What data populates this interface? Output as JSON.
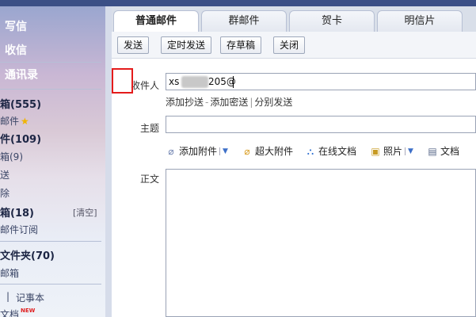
{
  "sidebar": {
    "write": "写信",
    "inbox": "收信",
    "contacts": "通讯录",
    "inbox_count": "箱(555)",
    "starred": "邮件",
    "unread": "件(109)",
    "drafts": "箱(9)",
    "sent": "送",
    "deleted": "除",
    "junk": "箱(18)",
    "junk_clear": "[清空]",
    "subscriptions": "邮件订阅",
    "folders": "文件夹(70)",
    "other_mailbox": "邮箱",
    "notes_sep": "|",
    "notes": "记事本",
    "docs": "文档",
    "new_badge": "NEW"
  },
  "tabs": [
    {
      "label": "普通邮件",
      "active": true
    },
    {
      "label": "群邮件",
      "active": false
    },
    {
      "label": "贺卡",
      "active": false
    },
    {
      "label": "明信片",
      "active": false
    }
  ],
  "toolbar": {
    "send": "发送",
    "scheduled_send": "定时发送",
    "save_draft": "存草稿",
    "close": "关闭"
  },
  "compose": {
    "to_label": "收件人",
    "to_value_start": "xs",
    "to_value_end": "205@",
    "add_cc": "添加抄送",
    "add_bcc": "添加密送",
    "separate_send": "分别发送",
    "link_sep_1": "-",
    "link_sep_2": "|",
    "subject_label": "主题",
    "subject_value": "",
    "body_label": "正文"
  },
  "attachments": {
    "add_attachment": "添加附件",
    "large_attachment": "超大附件",
    "online_docs": "在线文档",
    "photos": "照片",
    "document": "文档"
  },
  "colors": {
    "highlight_box": "#e41b1b",
    "link_blue": "#3d6fc8",
    "star": "#f0b400"
  }
}
